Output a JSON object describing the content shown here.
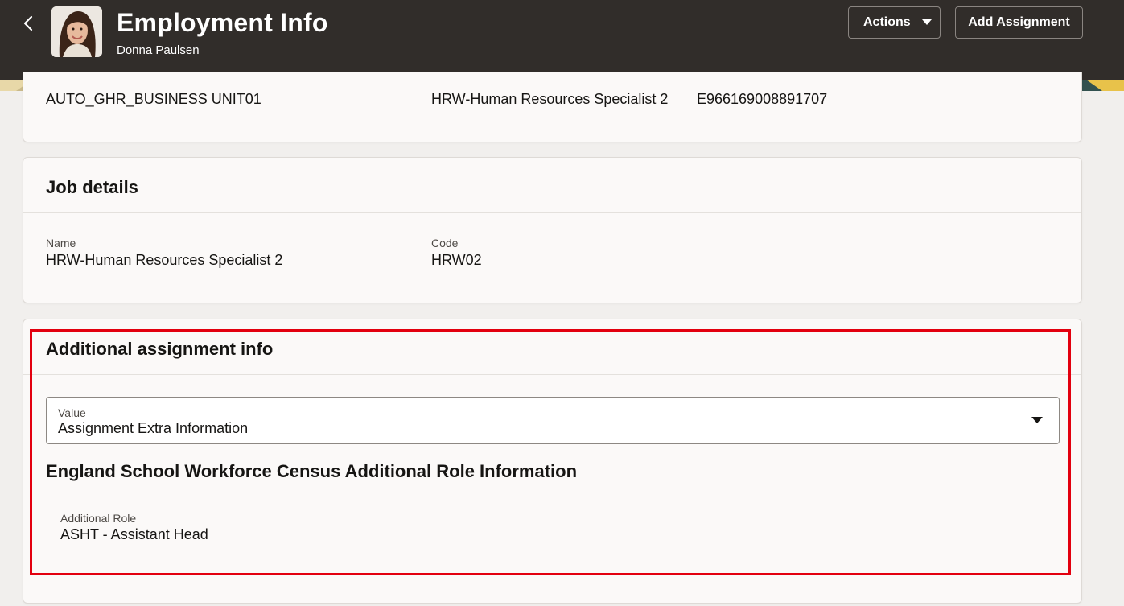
{
  "header": {
    "title": "Employment Info",
    "person_name": "Donna Paulsen",
    "actions_label": "Actions",
    "add_assignment_label": "Add Assignment"
  },
  "assignment_summary": {
    "business_unit": "AUTO_GHR_BUSINESS UNIT01",
    "job": "HRW-Human Resources Specialist 2",
    "assignment_number": "E966169008891707"
  },
  "job_details": {
    "title": "Job details",
    "name_label": "Name",
    "name_value": "HRW-Human Resources Specialist 2",
    "code_label": "Code",
    "code_value": "HRW02"
  },
  "additional_info": {
    "title": "Additional assignment info",
    "select_label": "Value",
    "select_value": "Assignment Extra Information",
    "section_title": "England School Workforce Census Additional Role Information",
    "role_label": "Additional Role",
    "role_value": "ASHT - Assistant Head"
  },
  "colors": {
    "header_bg": "#312d2a",
    "page_bg": "#f1efed",
    "highlight": "#e3000f"
  },
  "icons": {
    "back": "chevron-left-icon",
    "dropdown": "caret-down-icon"
  }
}
